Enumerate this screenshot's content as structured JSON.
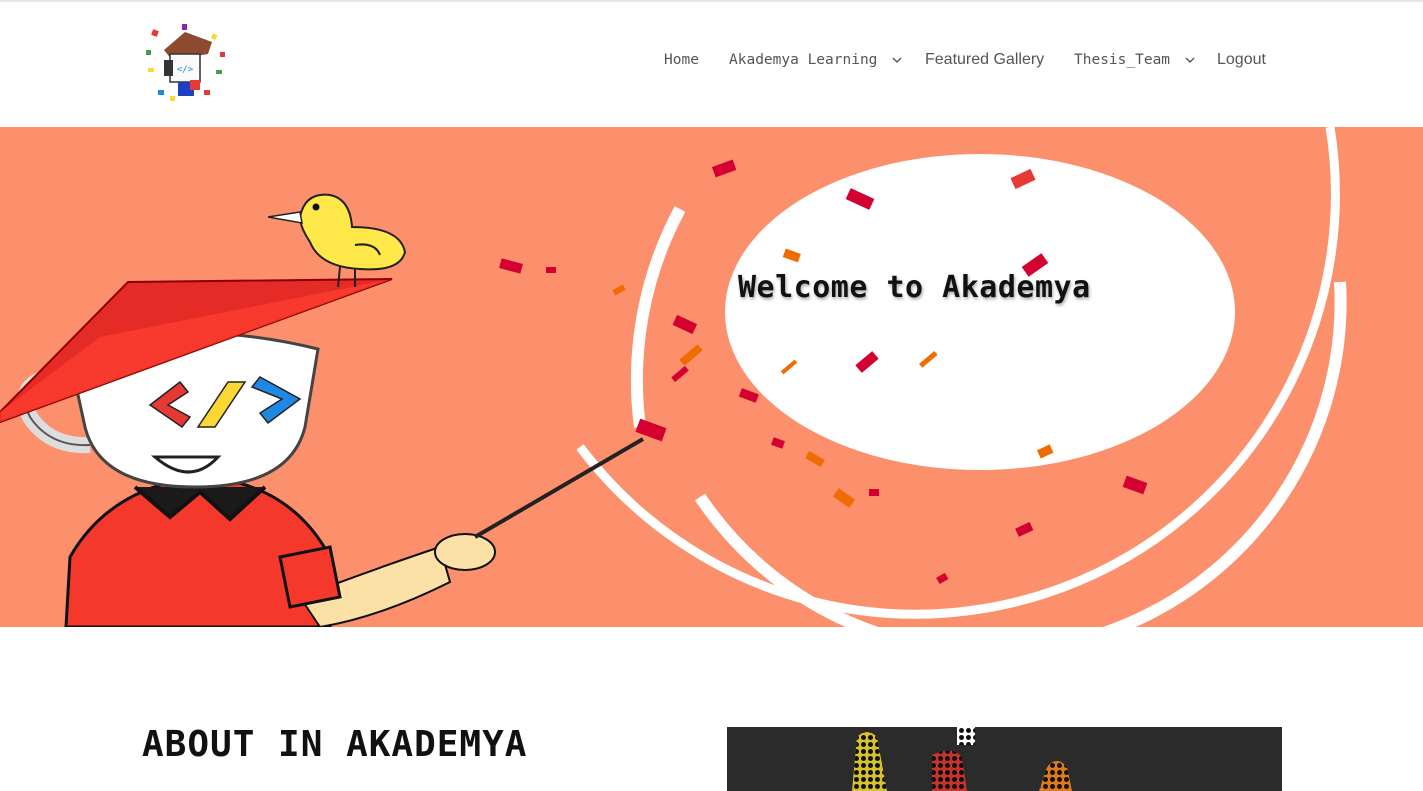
{
  "header": {
    "logo_icon": "akademya-logo-icon",
    "nav": [
      {
        "label": "Home",
        "has_dropdown": false
      },
      {
        "label": "Akademya Learning",
        "has_dropdown": true
      },
      {
        "label": "Featured Gallery",
        "has_dropdown": false
      },
      {
        "label": "Thesis_Team",
        "has_dropdown": true
      },
      {
        "label": "Logout",
        "has_dropdown": false
      }
    ]
  },
  "hero": {
    "title": "Welcome to Akademya",
    "background_color": "#fc8f6c",
    "illustration_icon": "teacup-teacher-illustration",
    "bird_icon": "yellow-bird-icon"
  },
  "about": {
    "title": "ABOUT IN AKADEMYA",
    "image_icon": "about-image-icon"
  },
  "colors": {
    "accent": "#fc8f6c",
    "nav_text": "#555555",
    "heading": "#111111"
  }
}
